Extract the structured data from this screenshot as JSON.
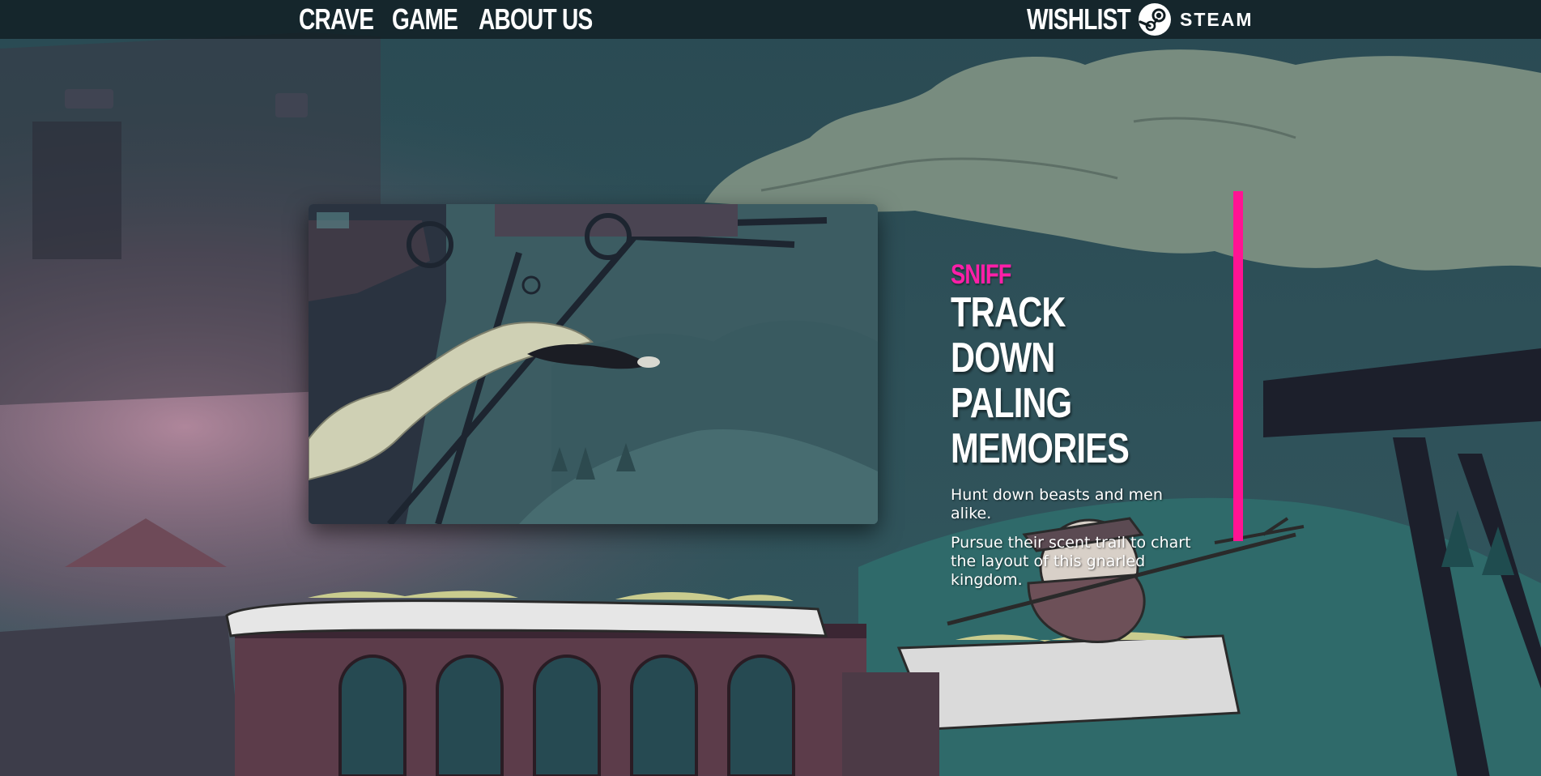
{
  "nav": {
    "links": [
      {
        "label": "CRAVE"
      },
      {
        "label": "GAME"
      },
      {
        "label": "ABOUT US"
      }
    ],
    "wishlist_label": "WISHLIST",
    "steam": {
      "icon": "steam-icon",
      "label": "STEAM"
    }
  },
  "feature": {
    "eyebrow": "SNIFF",
    "headline_lines": [
      "TRACK DOWN",
      "PALING",
      "MEMORIES"
    ],
    "paragraphs": [
      "Hunt down beasts and men alike.",
      "Pursue their scent trail to chart the layout of this gnarled kingdom."
    ]
  },
  "colors": {
    "accent": "#ff1493",
    "nav_bg": "#101c21",
    "sky": "#2e5058",
    "text": "#ffffff"
  }
}
